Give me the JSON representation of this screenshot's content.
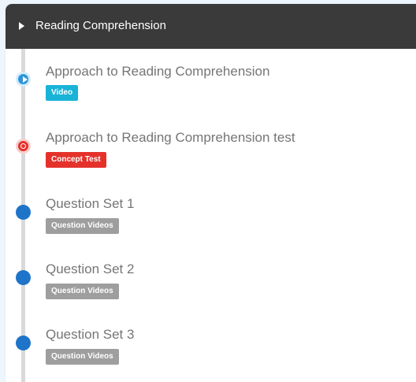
{
  "section": {
    "title": "Reading Comprehension"
  },
  "items": [
    {
      "title": "Approach to Reading Comprehension",
      "badge": "Video",
      "badge_color": "#1ab3d8",
      "icon": "play-icon"
    },
    {
      "title": "Approach to Reading Comprehension test",
      "badge": "Concept Test",
      "badge_color": "#e4322b",
      "icon": "timer-icon"
    },
    {
      "title": "Question Set 1",
      "badge": "Question Videos",
      "badge_color": "#9e9e9e",
      "icon": "dot-icon"
    },
    {
      "title": "Question Set 2",
      "badge": "Question Videos",
      "badge_color": "#9e9e9e",
      "icon": "dot-icon"
    },
    {
      "title": "Question Set 3",
      "badge": "Question Videos",
      "badge_color": "#9e9e9e",
      "icon": "dot-icon"
    }
  ],
  "colors": {
    "header_bg": "#3a3a3a",
    "timeline": "#d9d9d9",
    "node_blue": "#1e74c8"
  }
}
